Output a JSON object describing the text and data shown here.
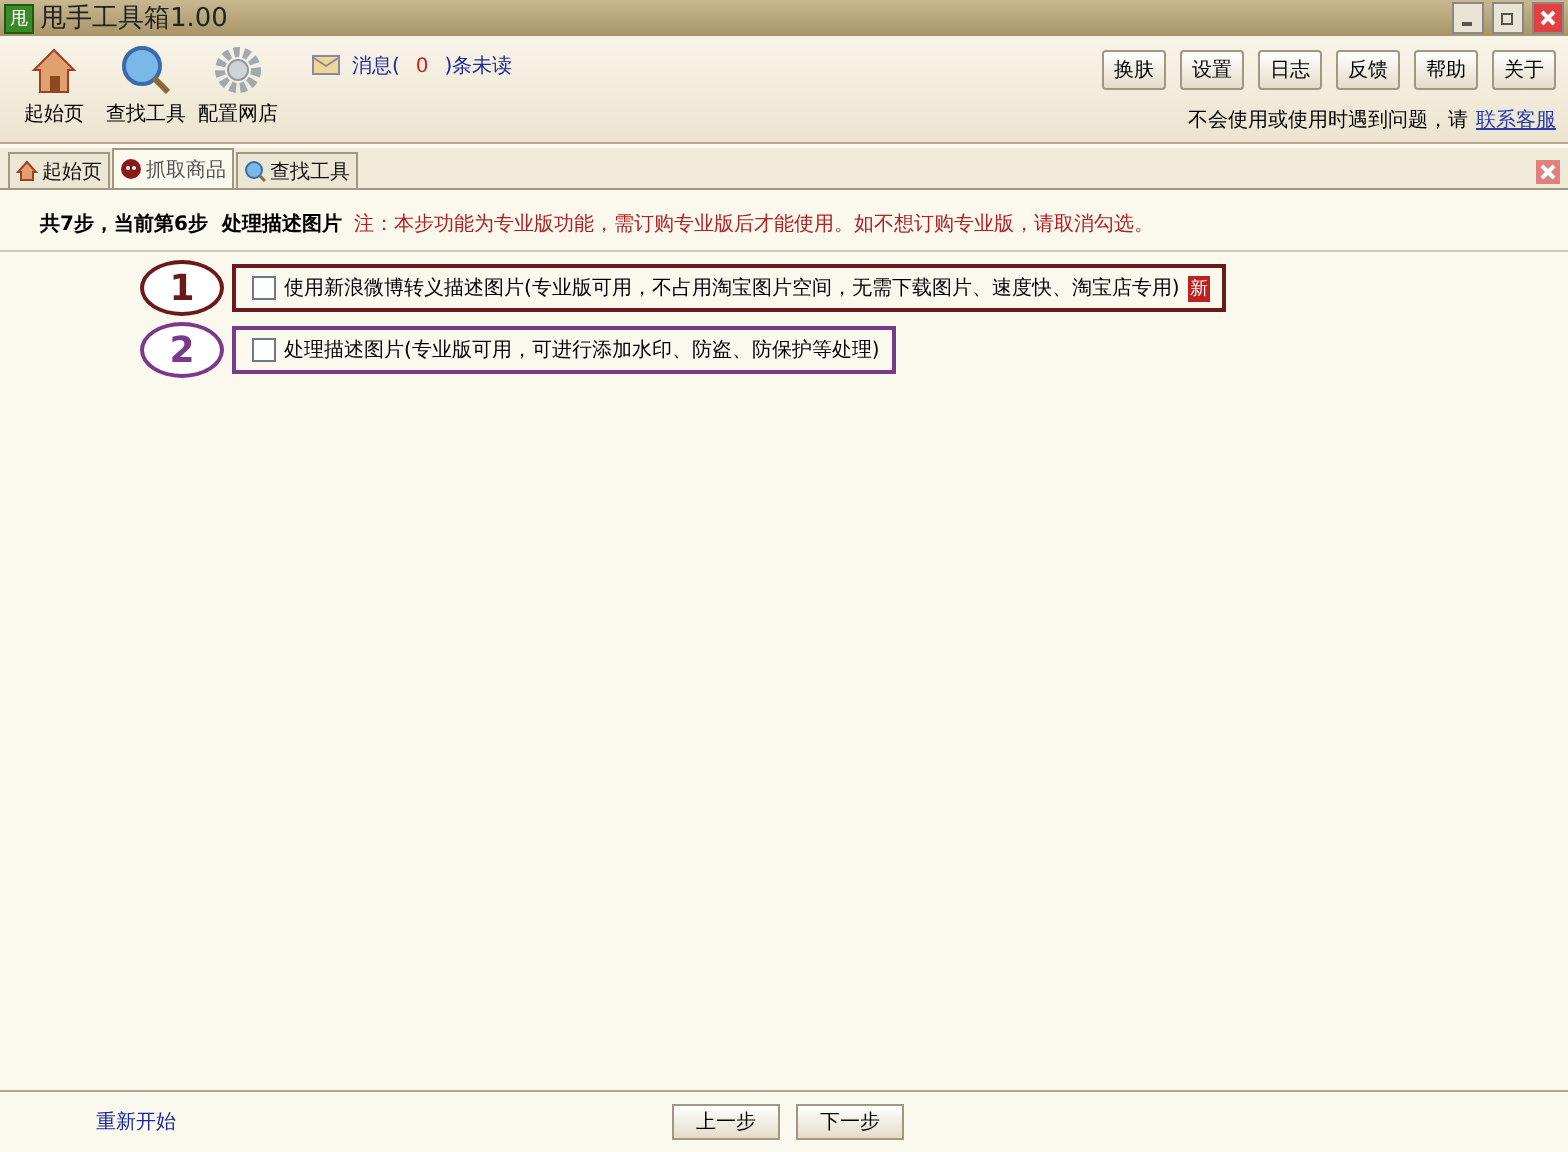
{
  "window": {
    "title": "甩手工具箱1.00",
    "logo": "甩"
  },
  "toolbar": {
    "tools": [
      {
        "kind": "home",
        "label": "起始页"
      },
      {
        "kind": "search",
        "label": "查找工具"
      },
      {
        "kind": "gear",
        "label": "配置网店"
      }
    ],
    "message": {
      "prefix": "消息(",
      "count": "0",
      "suffix": ")条未读"
    },
    "buttons": [
      "换肤",
      "设置",
      "日志",
      "反馈",
      "帮助",
      "关于"
    ],
    "help_text": "不会使用或使用时遇到问题，请",
    "help_link": "联系客服"
  },
  "tabs": [
    {
      "kind": "home",
      "label": "起始页",
      "selected": false
    },
    {
      "kind": "bug",
      "label": "抓取商品",
      "selected": true
    },
    {
      "kind": "search",
      "label": "查找工具",
      "selected": false
    }
  ],
  "step": {
    "title": "共7步，当前第6步  处理描述图片",
    "note": "注：本步功能为专业版功能，需订购专业版后才能使用。如不想订购专业版，请取消勾选。"
  },
  "options": [
    {
      "label": "使用新浪微博转义描述图片(专业版可用，不占用淘宝图片空间，无需下载图片、速度快、淘宝店专用)",
      "checked": false,
      "badge": "新",
      "callout": "1",
      "color": "#6b1a1a"
    },
    {
      "label": "处理描述图片(专业版可用，可进行添加水印、防盗、防保护等处理)",
      "checked": false,
      "callout": "2",
      "color": "#7a3a8a"
    }
  ],
  "footer": {
    "restart": "重新开始",
    "prev": "上一步",
    "next": "下一步"
  }
}
